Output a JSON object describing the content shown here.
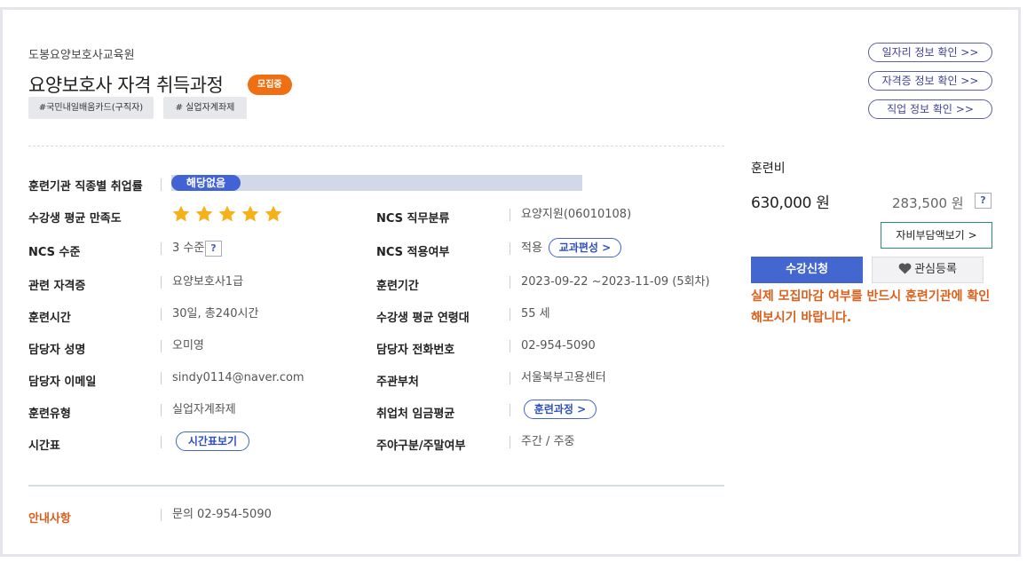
{
  "institution": "도봉요양보호사교육원",
  "course": {
    "title": "요양보호사 자격 취득과정",
    "badge": "모집중",
    "tags": [
      "#국민내일배움카드(구직자)",
      "# 실업자계좌제"
    ]
  },
  "links": [
    {
      "label": "일자리 정보 확인 >>"
    },
    {
      "label": "자격증 정보 확인 >>"
    },
    {
      "label": "직업 정보 확인 >>"
    }
  ],
  "details": {
    "employment": {
      "label": "훈련기관 직종별 취업률",
      "value": "해당없음"
    },
    "satisfaction": {
      "label": "수강생 평균 만족도",
      "rating": 5,
      "max": 5
    },
    "ncs_class": {
      "label": "NCS 직무분류",
      "value": "요양지원(06010108)"
    },
    "ncs_level": {
      "label": "NCS 수준",
      "value": "3 수준",
      "help": "?"
    },
    "ncs_apply": {
      "label": "NCS 적용여부",
      "value": "적용",
      "button": "교과편성 >"
    },
    "cert": {
      "label": "관련 자격증",
      "value": "요양보호사1급"
    },
    "period": {
      "label": "훈련기간",
      "value": "2023-09-22 ~2023-11-09 (5회차)"
    },
    "hours": {
      "label": "훈련시간",
      "value": "30일, 총240시간"
    },
    "age": {
      "label": "수강생 평균 연령대",
      "value": "55 세"
    },
    "manager": {
      "label": "담당자 성명",
      "value": "오미영"
    },
    "phone": {
      "label": "담당자 전화번호",
      "value": "02-954-5090"
    },
    "email": {
      "label": "담당자 이메일",
      "value": "sindy0114@naver.com"
    },
    "dept": {
      "label": "주관부처",
      "value": "서울북부고용센터"
    },
    "type": {
      "label": "훈련유형",
      "value": "실업자계좌제"
    },
    "wage": {
      "label": "취업처 임금평균",
      "button": "훈련과정 >"
    },
    "schedule": {
      "label": "시간표",
      "button": "시간표보기"
    },
    "daynight": {
      "label": "주야구분/주말여부",
      "value": "주간 / 주중"
    }
  },
  "notice": {
    "label": "안내사항",
    "value": "문의 02-954-5090"
  },
  "fee": {
    "label": "훈련비",
    "amount": "630,000 원",
    "self_amount": "283,500 원",
    "help": "?",
    "self_button": "자비부담액보기 >",
    "apply_button": "수강신청",
    "fav_button": "관심등록",
    "warning": "실제 모집마감 여부를 반드시 훈련기관에 확인해보시기 바랍니다."
  },
  "colors": {
    "accent": "#4466cf",
    "badge": "#f06f13",
    "warning": "#d9601b",
    "star": "#f5b01a"
  }
}
